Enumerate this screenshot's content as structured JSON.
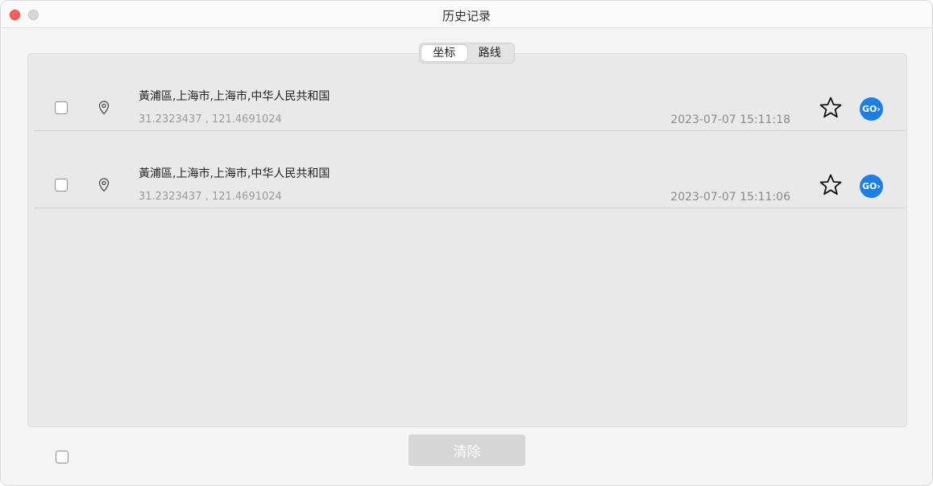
{
  "window": {
    "title": "历史记录"
  },
  "tabs": [
    {
      "label": "坐标",
      "active": true
    },
    {
      "label": "路线",
      "active": false
    }
  ],
  "records": [
    {
      "address": "黃浦區,上海市,上海市,中华人民共和国",
      "coordinates": "31.2323437 , 121.4691024",
      "time": "2023-07-07 15:11:18",
      "checked": false
    },
    {
      "address": "黃浦區,上海市,上海市,中华人民共和国",
      "coordinates": "31.2323437 , 121.4691024",
      "time": "2023-07-07 15:11:06",
      "checked": false
    }
  ],
  "go_label": "GO",
  "footer": {
    "clear_label": "清除",
    "select_all_checked": false
  },
  "colors": {
    "close": "#fe5f57",
    "go_button": "#1a7fe6",
    "clear_button_disabled": "#d6d6d6"
  },
  "icons": {
    "pin": "location-pin-icon",
    "star": "star-outline-icon",
    "go": "go-chevron-icon"
  }
}
